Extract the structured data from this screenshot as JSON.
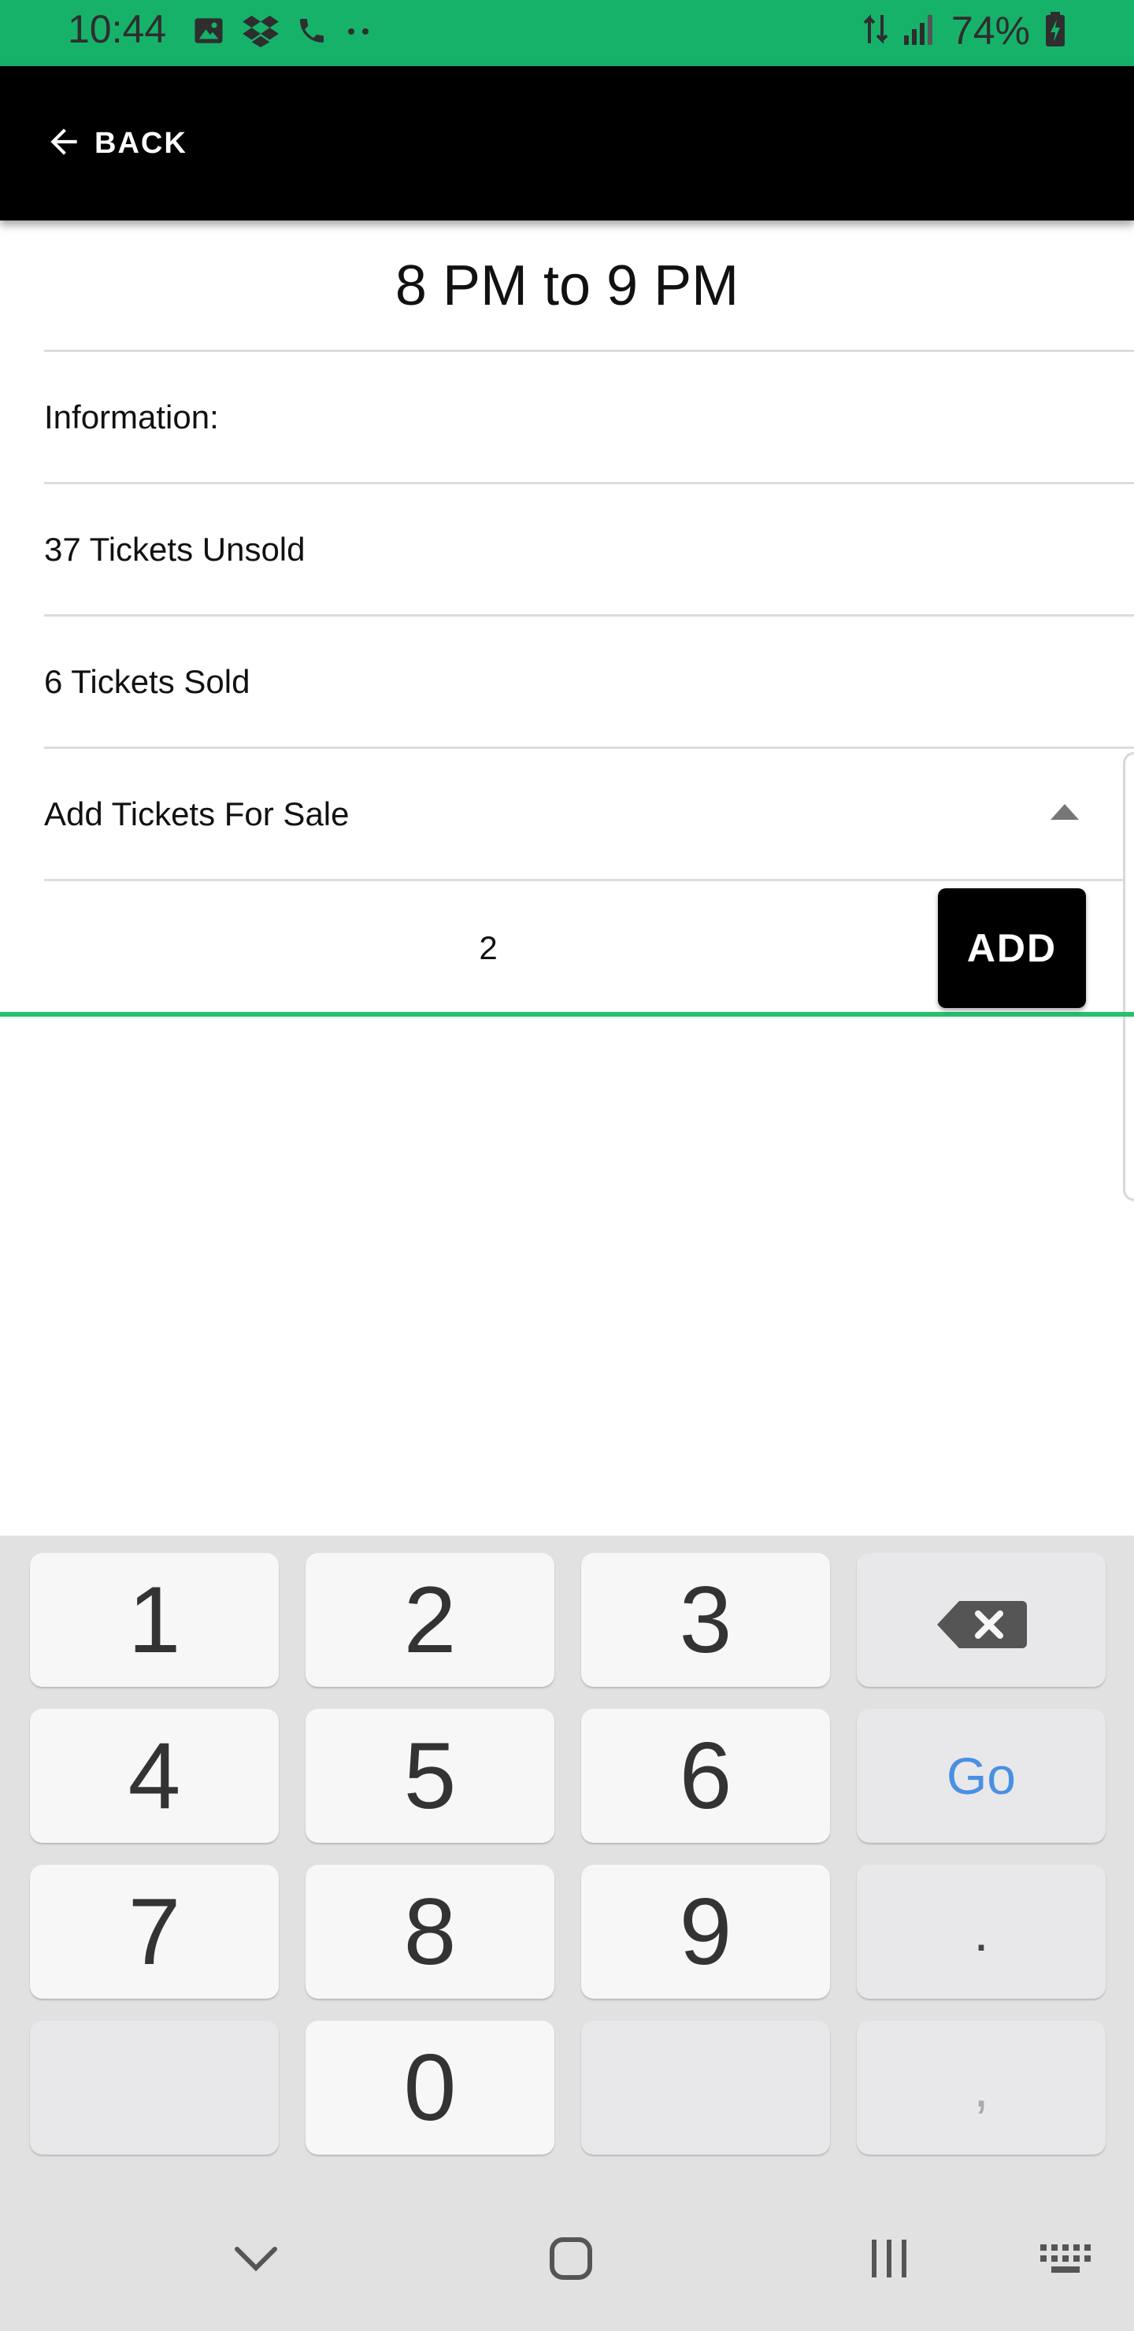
{
  "status_bar": {
    "time": "10:44",
    "battery": "74%",
    "left_icons": [
      "image-icon",
      "dropbox-icon",
      "phone-icon",
      "more-dots-icon"
    ],
    "right_icons": [
      "data-arrows-icon",
      "signal-icon",
      "battery-charging-icon"
    ]
  },
  "app_bar": {
    "back_label": "BACK"
  },
  "slot": {
    "title": "8 PM to 9 PM"
  },
  "rows": {
    "information_label": "Information:",
    "unsold": "37 Tickets Unsold",
    "sold": "6 Tickets Sold",
    "add_section_label": "Add Tickets For Sale"
  },
  "add_form": {
    "quantity_value": "2",
    "add_button_label": "ADD"
  },
  "keyboard": {
    "keys": {
      "k1": "1",
      "k2": "2",
      "k3": "3",
      "k4": "4",
      "k5": "5",
      "k6": "6",
      "k7": "7",
      "k8": "8",
      "k9": "9",
      "k0": "0",
      "go": "Go",
      "period": ".",
      "comma": ","
    }
  },
  "colors": {
    "status_bar": "#17b26a",
    "accent_underline": "#23c26e",
    "go_key": "#4a90e2"
  }
}
